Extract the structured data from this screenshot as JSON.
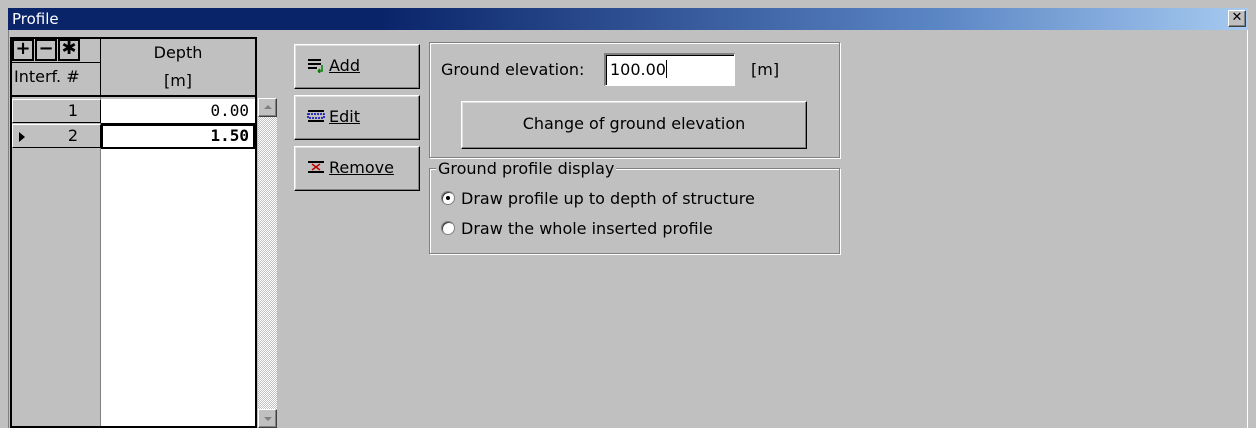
{
  "window": {
    "title": "Profile",
    "close_glyph": "✕"
  },
  "grid": {
    "toolbar": {
      "add_glyph": "+",
      "remove_glyph": "−",
      "all_glyph": "✱"
    },
    "col_index_label": "Interf. #",
    "col_depth_label": "Depth",
    "col_depth_unit": "[m]",
    "rows": [
      {
        "index": "1",
        "depth": "0.00",
        "selected": false
      },
      {
        "index": "2",
        "depth": "1.50",
        "selected": true
      }
    ]
  },
  "actions": {
    "add_label": "Add",
    "edit_label": "Edit",
    "remove_label": "Remove"
  },
  "ground": {
    "label": "Ground elevation:",
    "value": "100.00",
    "unit": "[m]",
    "change_button": "Change of ground elevation"
  },
  "display": {
    "legend": "Ground profile display",
    "options": [
      {
        "label": "Draw profile up to depth of structure",
        "checked": true
      },
      {
        "label": "Draw the whole inserted profile",
        "checked": false
      }
    ]
  }
}
